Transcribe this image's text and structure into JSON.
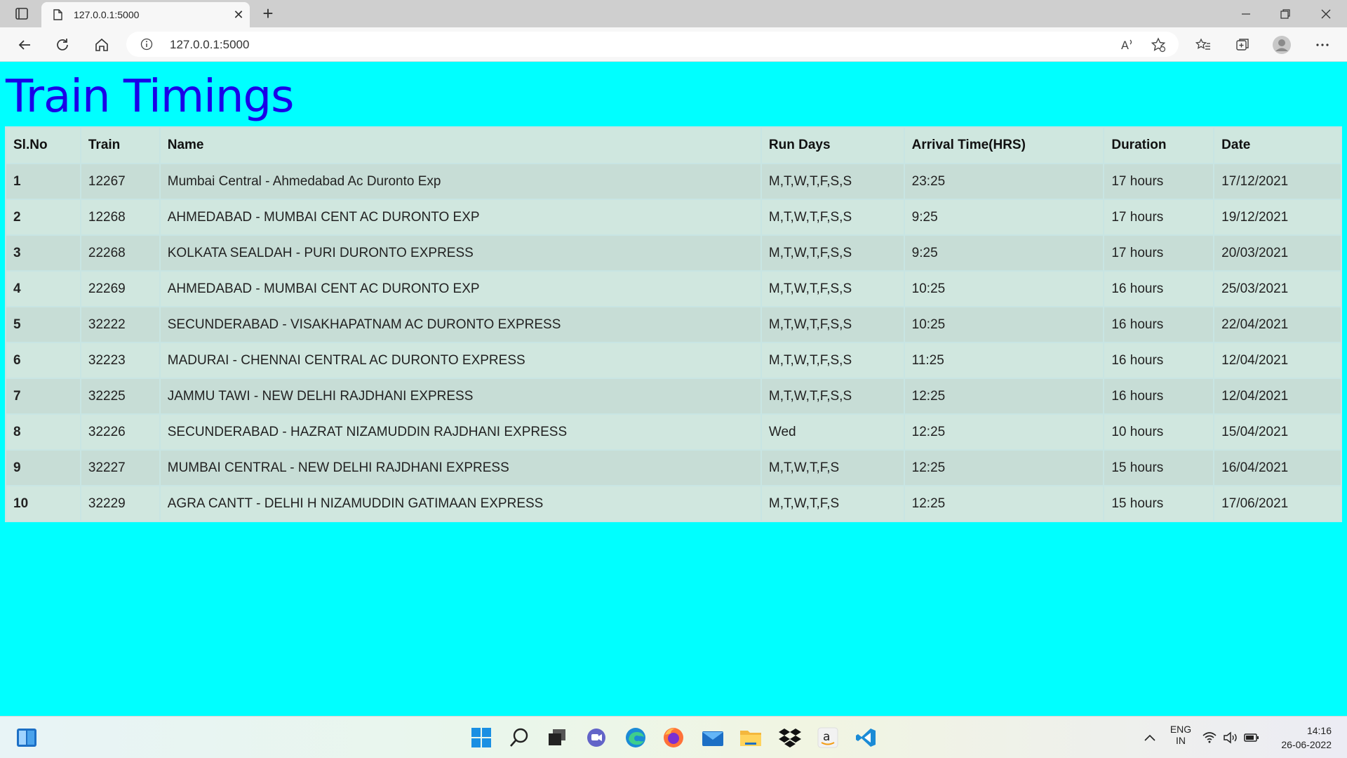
{
  "browser": {
    "tab_title": "127.0.0.1:5000",
    "url": "127.0.0.1:5000"
  },
  "page": {
    "title": "Train Timings"
  },
  "table": {
    "headers": [
      "Sl.No",
      "Train",
      "Name",
      "Run Days",
      "Arrival Time(HRS)",
      "Duration",
      "Date"
    ],
    "rows": [
      [
        "1",
        "12267",
        "Mumbai Central - Ahmedabad Ac Duronto Exp",
        "M,T,W,T,F,S,S",
        "23:25",
        "17 hours",
        "17/12/2021"
      ],
      [
        "2",
        "12268",
        "AHMEDABAD - MUMBAI CENT AC DURONTO EXP",
        "M,T,W,T,F,S,S",
        "9:25",
        "17 hours",
        "19/12/2021"
      ],
      [
        "3",
        "22268",
        "KOLKATA SEALDAH - PURI DURONTO EXPRESS",
        "M,T,W,T,F,S,S",
        "9:25",
        "17 hours",
        "20/03/2021"
      ],
      [
        "4",
        "22269",
        "AHMEDABAD - MUMBAI CENT AC DURONTO EXP",
        "M,T,W,T,F,S,S",
        "10:25",
        "16 hours",
        "25/03/2021"
      ],
      [
        "5",
        "32222",
        "SECUNDERABAD - VISAKHAPATNAM AC DURONTO EXPRESS",
        "M,T,W,T,F,S,S",
        "10:25",
        "16 hours",
        "22/04/2021"
      ],
      [
        "6",
        "32223",
        "MADURAI - CHENNAI CENTRAL AC DURONTO EXPRESS",
        "M,T,W,T,F,S,S",
        "11:25",
        "16 hours",
        "12/04/2021"
      ],
      [
        "7",
        "32225",
        "JAMMU TAWI - NEW DELHI RAJDHANI EXPRESS",
        "M,T,W,T,F,S,S",
        "12:25",
        "16 hours",
        "12/04/2021"
      ],
      [
        "8",
        "32226",
        "SECUNDERABAD - HAZRAT NIZAMUDDIN RAJDHANI EXPRESS",
        "Wed",
        "12:25",
        "10 hours",
        "15/04/2021"
      ],
      [
        "9",
        "32227",
        "MUMBAI CENTRAL - NEW DELHI RAJDHANI EXPRESS",
        "M,T,W,T,F,S",
        "12:25",
        "15 hours",
        "16/04/2021"
      ],
      [
        "10",
        "32229",
        "AGRA CANTT - DELHI H NIZAMUDDIN GATIMAAN EXPRESS",
        "M,T,W,T,F,S",
        "12:25",
        "15 hours",
        "17/06/2021"
      ]
    ]
  },
  "taskbar": {
    "language_line1": "ENG",
    "language_line2": "IN",
    "time": "14:16",
    "date": "26-06-2022"
  },
  "colors": {
    "page_background": "#00ffff",
    "title_color": "#1a00e8",
    "header_background": "#cfe7df",
    "row_odd": "#c7ddd6",
    "row_even": "#d0e7df"
  }
}
